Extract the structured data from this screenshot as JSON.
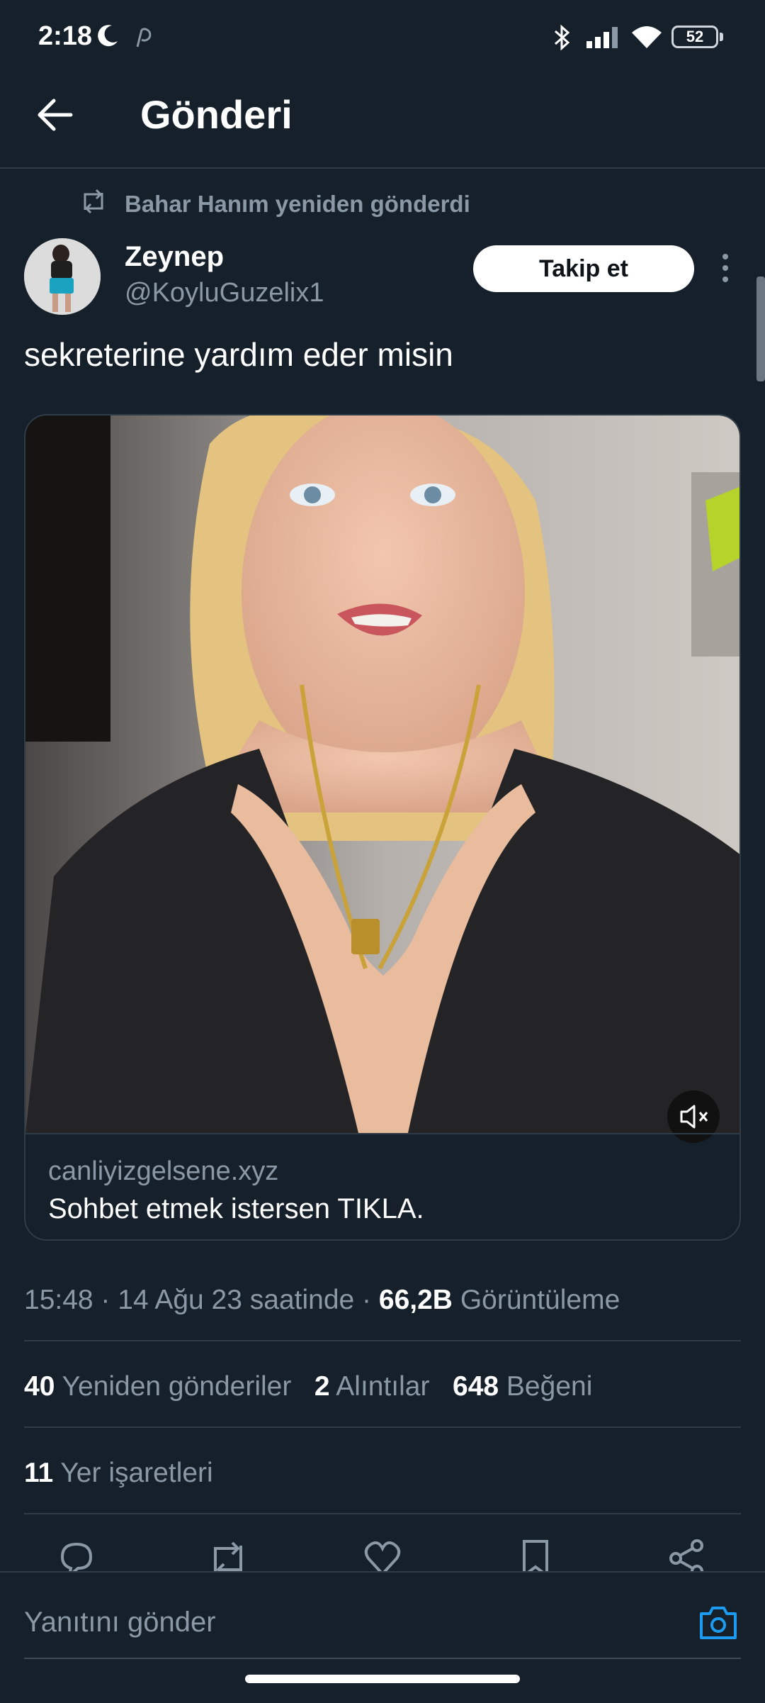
{
  "status_bar": {
    "time": "2:18",
    "battery": "52",
    "icons": [
      "moon-icon",
      "pinterest-icon",
      "bluetooth-icon",
      "signal-icon",
      "wifi-icon",
      "battery-icon"
    ]
  },
  "header": {
    "title": "Gönderi",
    "back_icon": "arrow-left-icon"
  },
  "post": {
    "repost_text": "Bahar Hanım yeniden gönderdi",
    "author_name": "Zeynep",
    "author_handle": "@KoyluGuzelix1",
    "follow_label": "Takip et",
    "text": "sekreterine yardım eder misin",
    "card": {
      "domain": "canliyizgelsene.xyz",
      "title": "Sohbet etmek istersen TIKLA."
    },
    "meta": {
      "time_date": "15:48 · 14 Ağu 23 saatinde ·",
      "views": "66,2B",
      "views_label": "Görüntüleme"
    },
    "stats": {
      "reposts": "40",
      "reposts_label": "Yeniden gönderiler",
      "quotes": "2",
      "quotes_label": "Alıntılar",
      "likes": "648",
      "likes_label": "Beğeni",
      "bookmarks": "11",
      "bookmarks_label": "Yer işaretleri"
    },
    "actions": [
      "reply-icon",
      "retweet-icon",
      "like-icon",
      "bookmark-icon",
      "share-icon"
    ]
  },
  "reply_bar": {
    "placeholder": "Yanıtını gönder"
  },
  "colors": {
    "background": "#15202b",
    "divider": "#2f3b47",
    "muted": "#8b98a5",
    "accent": "#1d9bf0"
  }
}
